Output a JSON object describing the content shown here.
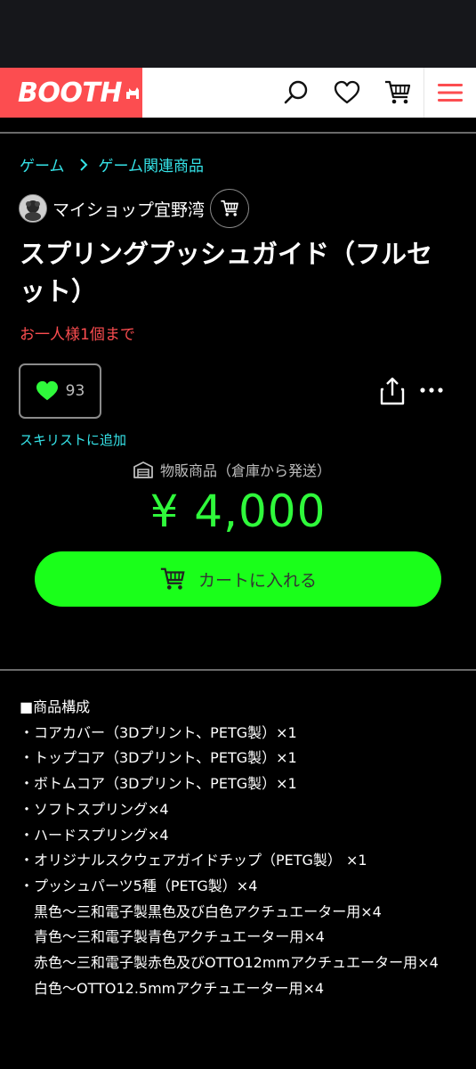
{
  "header": {
    "logo_text": "BOOTH",
    "icons": [
      "search-icon",
      "heart-icon",
      "cart-icon",
      "menu-icon"
    ],
    "brand_color": "#fc4d50"
  },
  "breadcrumb": {
    "items": [
      "ゲーム",
      "ゲーム関連商品"
    ]
  },
  "shop": {
    "name": "マイショップ宜野湾"
  },
  "product": {
    "title": "スプリングプッシュガイド（フルセット）",
    "purchase_limit": "お一人様1個まで",
    "like_count": "93",
    "wishlist_label": "スキリストに追加",
    "shipping_type": "物販商品（倉庫から発送）",
    "price": "¥ 4,000",
    "cart_button_label": "カートに入れる"
  },
  "description": {
    "lines": [
      "■商品構成",
      "・コアカバー（3Dプリント、PETG製）×1",
      "・トップコア（3Dプリント、PETG製）×1",
      "・ボトムコア（3Dプリント、PETG製）×1",
      "・ソフトスプリング×4",
      "・ハードスプリング×4",
      "・オリジナルスクウェアガイドチップ（PETG製） ×1",
      "・プッシュパーツ5種（PETG製）×4",
      "　黒色〜三和電子製黒色及び白色アクチュエーター用×4",
      "　青色〜三和電子製青色アクチュエーター用×4",
      "　赤色〜三和電子製赤色及びOTTO12mmアクチュエーター用×4",
      "　白色〜OTTO12.5mmアクチュエーター用×4"
    ]
  },
  "colors": {
    "accent_link": "#35e3e8",
    "price_green": "#2ff93b",
    "cart_button": "#1aff1a",
    "limit_red": "#fc4d50"
  }
}
